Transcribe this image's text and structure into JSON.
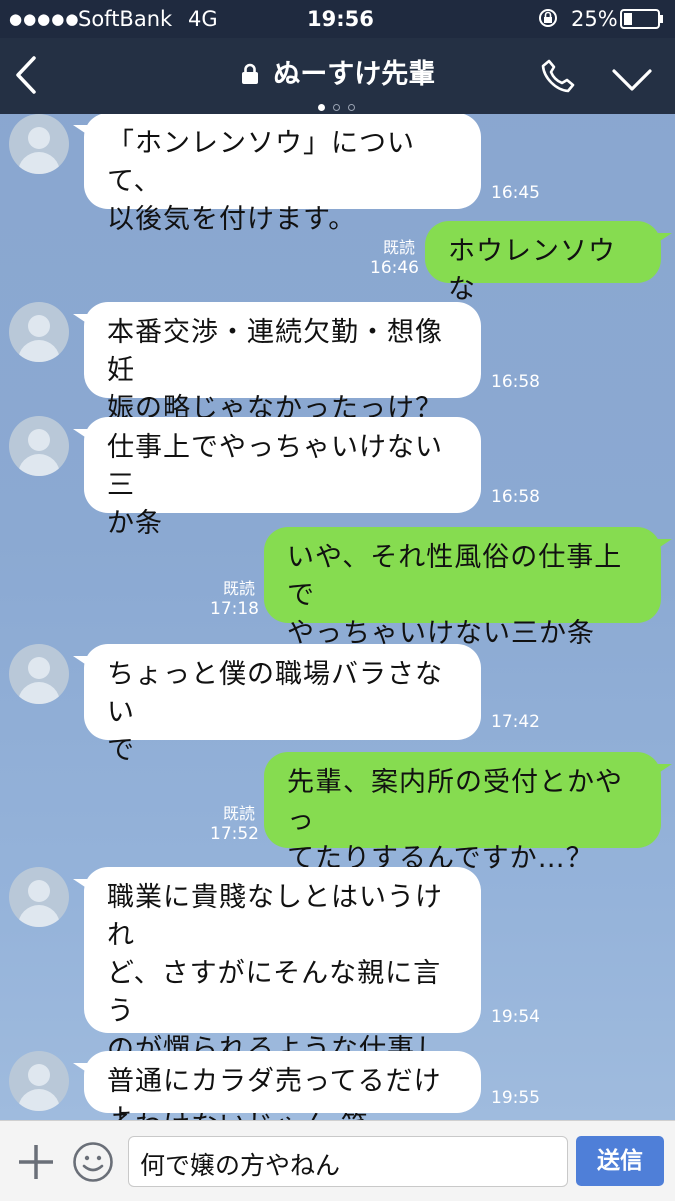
{
  "status_bar": {
    "carrier": "SoftBank",
    "network": "4G",
    "time": "19:56",
    "battery": "25%"
  },
  "header": {
    "title": "ぬーすけ先輩"
  },
  "messages": [
    {
      "side": "left",
      "text": "「ホンレンソウ」について、\n以後気を付けます。",
      "time": "16:45"
    },
    {
      "side": "right",
      "text": "ホウレンソウな",
      "read": "既読",
      "time": "16:46"
    },
    {
      "side": "left",
      "text": "本番交渉・連続欠勤・想像妊\n娠の略じゃなかったっけ？",
      "time": "16:58"
    },
    {
      "side": "left",
      "text": "仕事上でやっちゃいけない三\nか条",
      "time": "16:58"
    },
    {
      "side": "right",
      "text": "いや、それ性風俗の仕事上で\nやっちゃいけない三か条な。",
      "read": "既読",
      "time": "17:18"
    },
    {
      "side": "left",
      "text": "ちょっと僕の職場バラさない\nで",
      "time": "17:42"
    },
    {
      "side": "right",
      "text": "先輩、案内所の受付とかやっ\nてたりするんですか…？",
      "read": "既読",
      "time": "17:52"
    },
    {
      "side": "left",
      "text": "職業に貴賤なしとはいうけれ\nど、さすがにそんな親に言う\nのが憚られるような仕事して\nるわけないじゃん 笑",
      "time": "19:54"
    },
    {
      "side": "left",
      "text": "普通にカラダ売ってるだけよ",
      "time": "19:55"
    }
  ],
  "input": {
    "value": "何で嬢の方やねん",
    "send_label": "送信"
  },
  "colors": {
    "header_bg": "#243044",
    "bubble_sent": "#86dc50",
    "bubble_received": "#ffffff",
    "send_button": "#4f7fd8"
  },
  "icons": [
    "signal-dots-icon",
    "battery-icon",
    "rotation-lock-icon",
    "back-icon",
    "lock-icon",
    "phone-icon",
    "chevron-down-icon",
    "plus-icon",
    "emoji-icon"
  ]
}
